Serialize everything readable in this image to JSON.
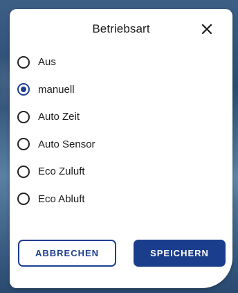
{
  "dialog": {
    "title": "Betriebsart",
    "close_icon": "close-icon"
  },
  "options": [
    {
      "label": "Aus",
      "selected": false
    },
    {
      "label": "manuell",
      "selected": true
    },
    {
      "label": "Auto Zeit",
      "selected": false
    },
    {
      "label": "Auto Sensor",
      "selected": false
    },
    {
      "label": "Eco Zuluft",
      "selected": false
    },
    {
      "label": "Eco Abluft",
      "selected": false
    }
  ],
  "actions": {
    "cancel_label": "ABBRECHEN",
    "save_label": "SPEICHERN"
  },
  "colors": {
    "accent": "#1a3e8c",
    "text": "#1a1a1a"
  }
}
